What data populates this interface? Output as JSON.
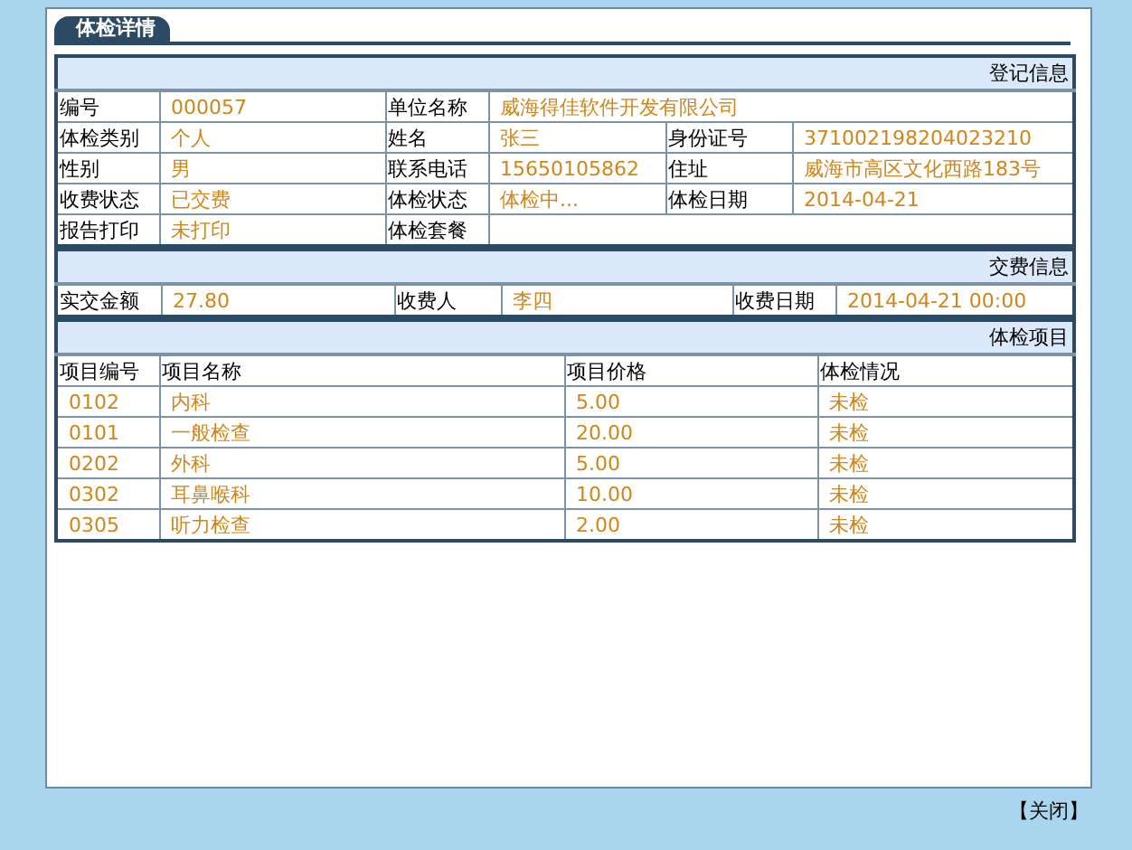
{
  "tab": {
    "title": "体检详情",
    "selected": true
  },
  "registration": {
    "title": "登记信息",
    "rows": [
      [
        {
          "label": "编号",
          "value": "000057"
        },
        {
          "label": "单位名称",
          "value": "威海得佳软件开发有限公司"
        }
      ],
      [
        {
          "label": "体检类别",
          "value": "个人"
        },
        {
          "label": "姓名",
          "value": "张三"
        },
        {
          "label": "身份证号",
          "value": "371002198204023210"
        }
      ],
      [
        {
          "label": "性别",
          "value": "男"
        },
        {
          "label": "联系电话",
          "value": "15650105862"
        },
        {
          "label": "住址",
          "value": "威海市高区文化西路183号"
        }
      ],
      [
        {
          "label": "收费状态",
          "value": "已交费"
        },
        {
          "label": "体检状态",
          "value": "体检中..."
        },
        {
          "label": "体检日期",
          "value": "2014-04-21"
        }
      ],
      [
        {
          "label": "报告打印",
          "value": "未打印"
        },
        {
          "label": "体检套餐"
        }
      ]
    ]
  },
  "payment": {
    "title": "交费信息",
    "rows": [
      [
        {
          "label": "实交金额",
          "value": "27.80"
        },
        {
          "label": "收费人",
          "value": "李四"
        },
        {
          "label": "收费日期",
          "value": "2014-04-21 00:00"
        }
      ]
    ]
  },
  "items": {
    "title": "体检项目",
    "columns": [
      "项目编号",
      "项目名称",
      "项目价格",
      "体检情况"
    ],
    "rows": [
      [
        "0102",
        "内科",
        "5.00",
        "未检"
      ],
      [
        "0101",
        "一般检查",
        "20.00",
        "未检"
      ],
      [
        "0202",
        "外科",
        "5.00",
        "未检"
      ],
      [
        "0302",
        "耳鼻喉科",
        "10.00",
        "未检"
      ],
      [
        "0305",
        "听力检查",
        "2.00",
        "未检"
      ]
    ]
  },
  "close_button": "【关闭】"
}
